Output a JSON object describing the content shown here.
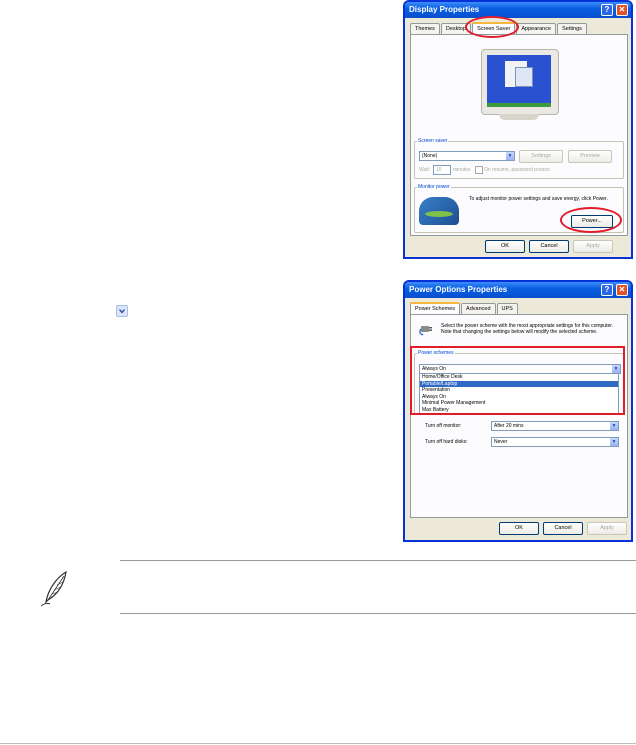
{
  "display_properties": {
    "title": "Display Properties",
    "tabs": [
      "Themes",
      "Desktop",
      "Screen Saver",
      "Appearance",
      "Settings"
    ],
    "active_tab": "Screen Saver",
    "screen_saver_group": "Screen saver",
    "screen_saver_value": "(None)",
    "settings_button": "Settings",
    "preview_button": "Preview",
    "wait_label": "Wait:",
    "wait_value": "10",
    "wait_units": "minutes",
    "password_checkbox": "On resume, password protect",
    "monitor_power_group": "Monitor power",
    "monitor_power_text": "To adjust monitor power settings and save energy, click Power.",
    "power_button": "Power...",
    "ok_button": "OK",
    "cancel_button": "Cancel",
    "apply_button": "Apply"
  },
  "power_options": {
    "title": "Power Options Properties",
    "tabs": [
      "Power Schemes",
      "Advanced",
      "UPS"
    ],
    "active_tab": "Power Schemes",
    "intro_text": "Select the power scheme with the most appropriate settings for this computer. Note that changing the settings below will modify the selected scheme.",
    "power_schemes_group": "Power schemes",
    "scheme_selected": "Always On",
    "scheme_options": [
      "Home/Office Desk",
      "Portable/Laptop",
      "Presentation",
      "Always On",
      "Minimal Power Management",
      "Max Battery"
    ],
    "highlighted_option": "Portable/Laptop",
    "turn_off_monitor_label": "Turn off monitor:",
    "turn_off_monitor_value": "After 20 mins",
    "turn_off_hard_disks_label": "Turn off hard disks:",
    "turn_off_hard_disks_value": "Never",
    "ok_button": "OK",
    "cancel_button": "Cancel",
    "apply_button": "Apply"
  },
  "colors": {
    "annotation_red": "#e21d2b",
    "xp_blue": "#0a5fe0",
    "dialog_bg": "#ece9d8"
  }
}
